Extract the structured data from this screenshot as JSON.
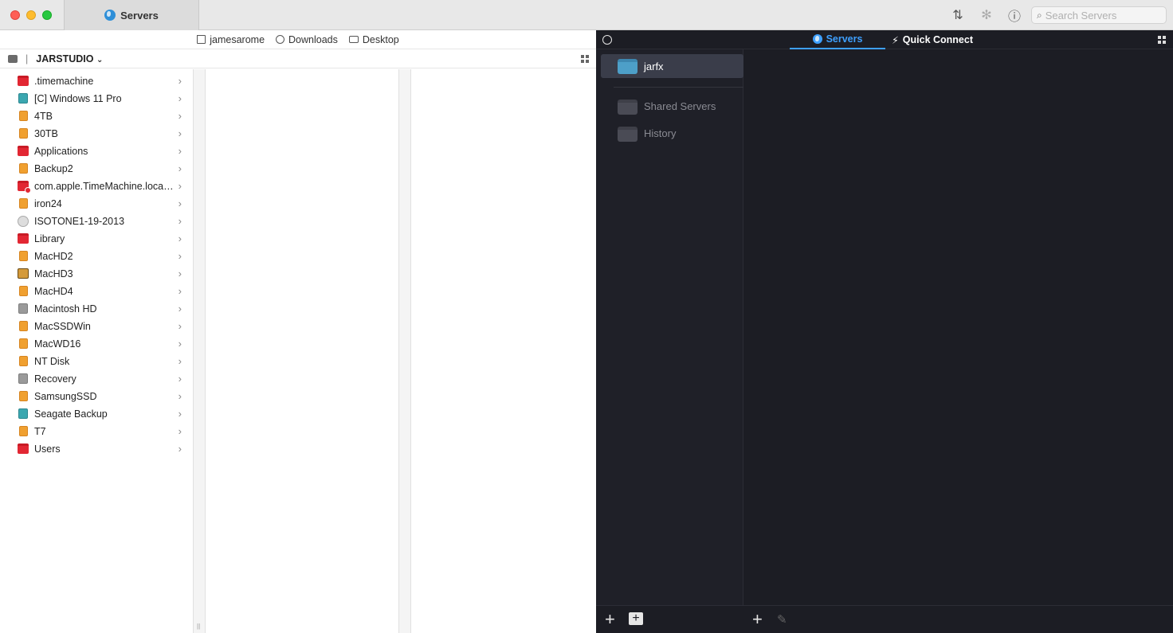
{
  "window": {
    "tab_title": "Servers"
  },
  "toolbar": {
    "search_placeholder": "Search Servers"
  },
  "left_panel": {
    "breadcrumbs": [
      "jamesarome",
      "Downloads",
      "Desktop"
    ],
    "location": "JARSTUDIO",
    "items": [
      {
        "label": ".timemachine",
        "icon": "folder-red"
      },
      {
        "label": "[C] Windows 11 Pro",
        "icon": "drive-teal"
      },
      {
        "label": "4TB",
        "icon": "drive-orange"
      },
      {
        "label": "30TB",
        "icon": "drive-orange"
      },
      {
        "label": "Applications",
        "icon": "folder-red"
      },
      {
        "label": "Backup2",
        "icon": "drive-orange"
      },
      {
        "label": "com.apple.TimeMachine.localsnapshots",
        "icon": "folder-red-badge"
      },
      {
        "label": "iron24",
        "icon": "drive-orange"
      },
      {
        "label": "ISOTONE1-19-2013",
        "icon": "disc"
      },
      {
        "label": "Library",
        "icon": "folder-red"
      },
      {
        "label": "MacHD2",
        "icon": "drive-orange"
      },
      {
        "label": "MacHD3",
        "icon": "drive-brown"
      },
      {
        "label": "MacHD4",
        "icon": "drive-orange"
      },
      {
        "label": "Macintosh HD",
        "icon": "drive-gray"
      },
      {
        "label": "MacSSDWin",
        "icon": "drive-orange"
      },
      {
        "label": "MacWD16",
        "icon": "drive-orange"
      },
      {
        "label": "NT Disk",
        "icon": "drive-orange"
      },
      {
        "label": "Recovery",
        "icon": "drive-gray"
      },
      {
        "label": "SamsungSSD",
        "icon": "drive-orange"
      },
      {
        "label": "Seagate Backup",
        "icon": "drive-teal"
      },
      {
        "label": "T7",
        "icon": "drive-orange"
      },
      {
        "label": "Users",
        "icon": "folder-red"
      }
    ]
  },
  "right_panel": {
    "tabs": [
      "Servers",
      "Quick Connect"
    ],
    "sidebar": {
      "selected": "jarfx",
      "shared": "Shared Servers",
      "history": "History"
    }
  },
  "colors": {
    "accent": "#3ea0ff",
    "dark_bg": "#1c1d24",
    "folder_red": "#e22733",
    "drive_orange": "#f0a030"
  }
}
